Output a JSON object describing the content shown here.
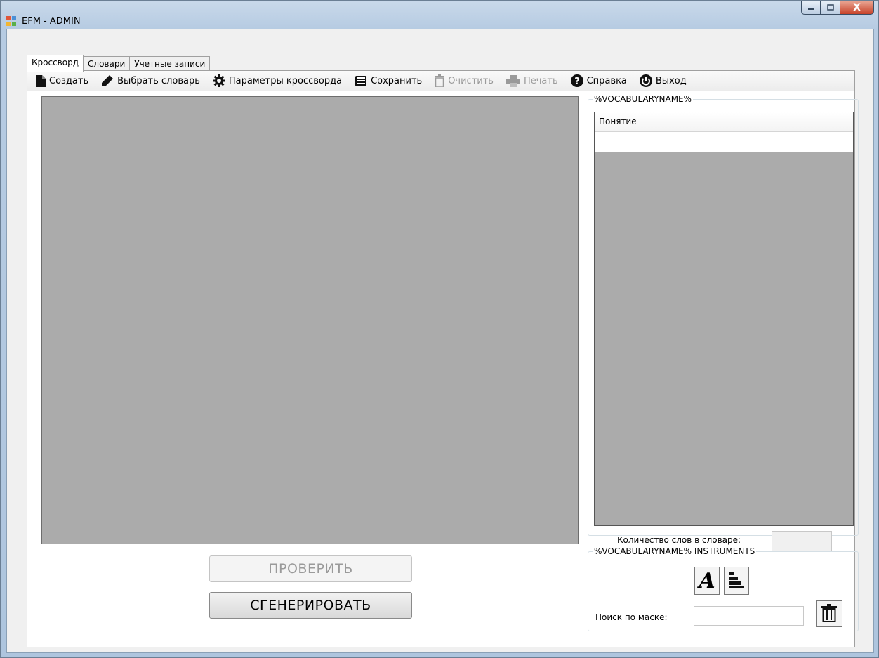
{
  "window": {
    "title": "EFM - ADMIN",
    "close_glyph": "X"
  },
  "tabs": [
    {
      "label": "Кроссворд",
      "active": true
    },
    {
      "label": "Словари",
      "active": false
    },
    {
      "label": "Учетные записи",
      "active": false
    }
  ],
  "toolbar": {
    "items": [
      {
        "label": "Создать",
        "icon": "new-document-icon",
        "enabled": true
      },
      {
        "label": "Выбрать словарь",
        "icon": "pencil-icon",
        "enabled": true
      },
      {
        "label": "Параметры кроссворда",
        "icon": "gear-icon",
        "enabled": true
      },
      {
        "label": "Сохранить",
        "icon": "save-icon",
        "enabled": true
      },
      {
        "label": "Очистить",
        "icon": "trash-icon",
        "enabled": false
      },
      {
        "label": "Печать",
        "icon": "printer-icon",
        "enabled": false
      },
      {
        "label": "Справка",
        "icon": "help-icon",
        "enabled": true
      },
      {
        "label": "Выход",
        "icon": "power-icon",
        "enabled": true
      }
    ]
  },
  "buttons": {
    "check_label": "ПРОВЕРИТЬ",
    "generate_label": "СГЕНЕРИРОВАТЬ"
  },
  "vocabulary_group": {
    "title": "%VOCABULARYNAME%",
    "column_header": "Понятие",
    "count_label": "Количество слов в словаре:",
    "count_value": ""
  },
  "instruments_group": {
    "title": "%VOCABULARYNAME% INSTRUMENTS",
    "font_button_glyph": "A",
    "search_label": "Поиск по маске:",
    "search_value": ""
  },
  "colors": {
    "canvas_bg": "#ababab",
    "panel_bg": "#ffffff",
    "disabled_text": "#9a9a9a",
    "close_button": "#c7432a"
  }
}
